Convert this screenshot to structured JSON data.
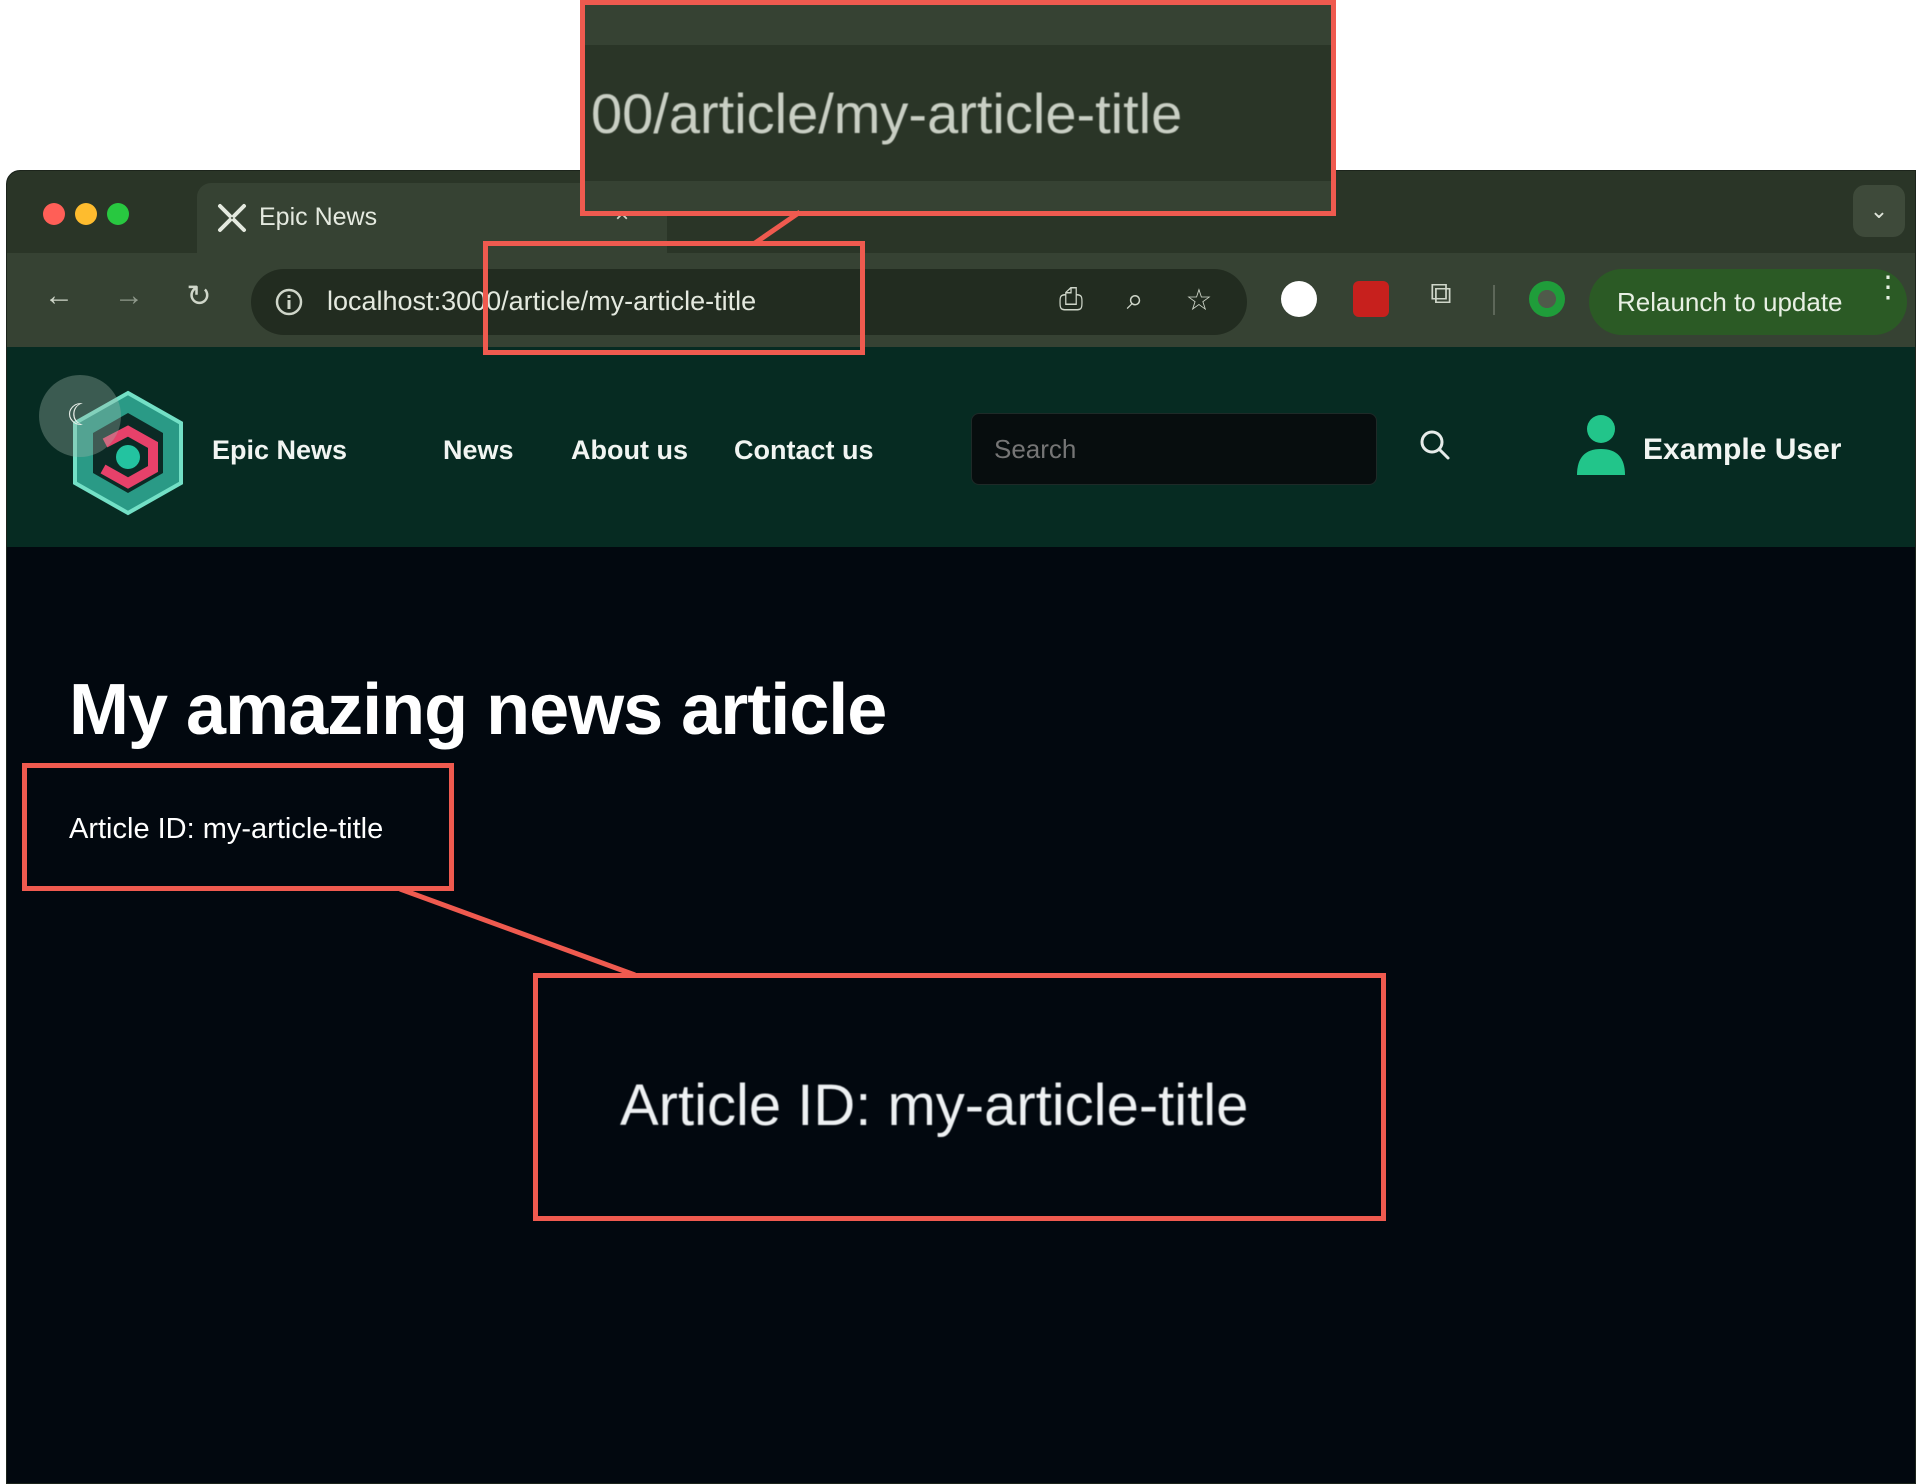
{
  "browser": {
    "tab_title": "Epic News",
    "tab_close": "×",
    "url": "localhost:3000/article/my-article-title",
    "relaunch_label": "Relaunch to update"
  },
  "site": {
    "brand": "Epic News",
    "nav": [
      "News",
      "About us",
      "Contact us"
    ],
    "search_placeholder": "Search",
    "user_name": "Example User"
  },
  "article": {
    "title": "My amazing news article",
    "id_label": "Article ID: my-article-title"
  },
  "callouts": {
    "url_zoom_text": "00/article/my-article-title",
    "id_zoom_text": "Article ID: my-article-title"
  },
  "colors": {
    "header_bg": "#062b22",
    "page_bg": "#02080f",
    "accent": "#22c58a",
    "callout": "#ef5a4f"
  },
  "icons": [
    "theme-toggle-icon",
    "search-icon",
    "user-icon",
    "back-icon",
    "forward-icon",
    "reload-icon",
    "info-icon",
    "install-icon",
    "zoom-icon",
    "star-icon",
    "extensions-icon",
    "more-icon"
  ]
}
